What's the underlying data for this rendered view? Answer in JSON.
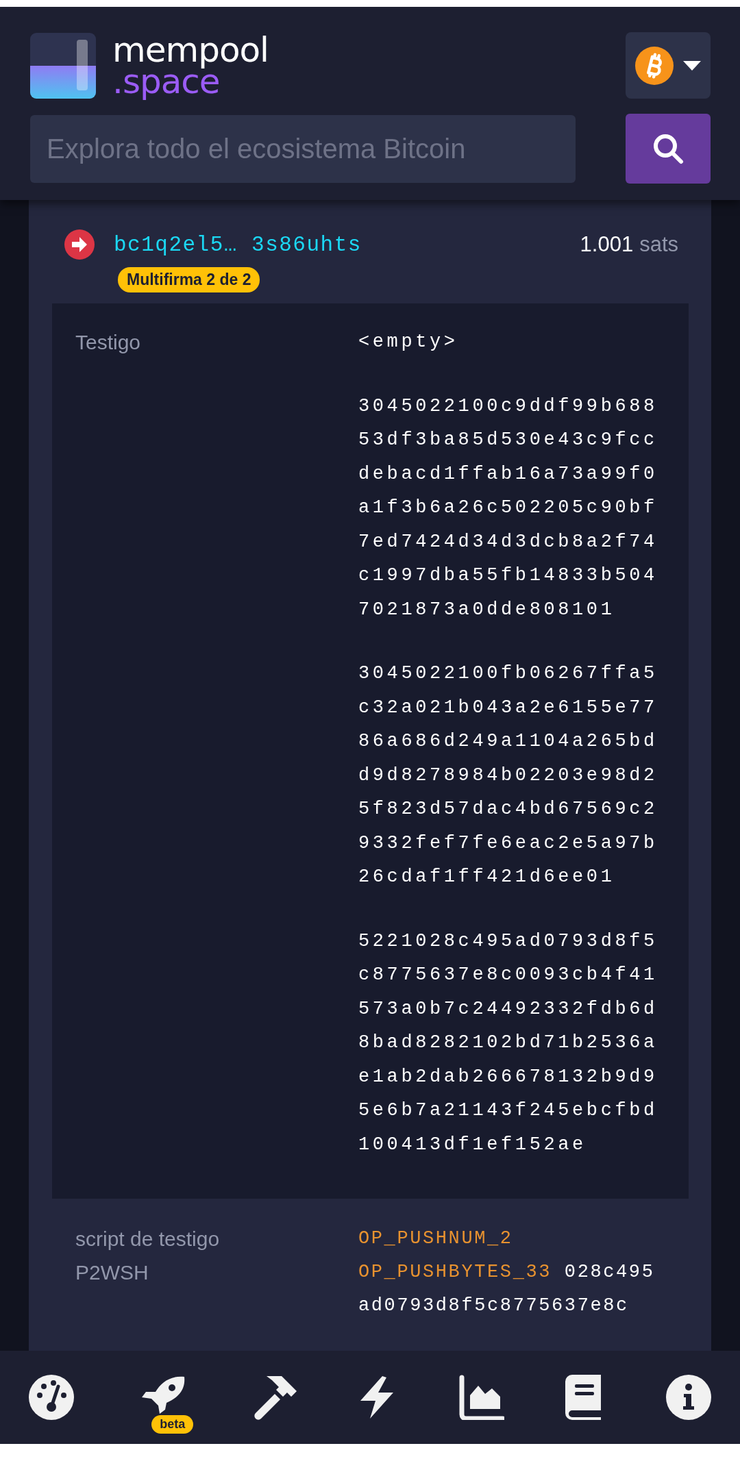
{
  "header": {
    "logo": {
      "line1": "mempool",
      "line2": ".space"
    },
    "search": {
      "placeholder": "Explora todo el ecosistema Bitcoin"
    }
  },
  "input": {
    "address": "bc1q2el5… 3s86uhts",
    "amount": "1.001",
    "unit": "sats",
    "badge": "Multifirma 2 de 2",
    "witness": {
      "label": "Testigo",
      "items": [
        "<empty>",
        "3045022100c9ddf99b68853df3ba85d530e43c9fccdebacd1ffab16a73a99f0a1f3b6a26c502205c90bf7ed7424d34d3dcb8a2f74c1997dba55fb14833b5047021873a0dde808101",
        "3045022100fb06267ffa5c32a021b043a2e6155e7786a686d249a1104a265bdd9d8278984b02203e98d25f823d57dac4bd67569c29332fef7fe6eac2e5a97b26cdaf1ff421d6ee01",
        "5221028c495ad0793d8f5c8775637e8c0093cb4f41573a0b7c24492332fdb6d8bad8282102bd71b2536ae1ab2dab266678132b9d95e6b7a21143f245ebcfbd100413df1ef152ae"
      ]
    },
    "script": {
      "label": "script de testigo P2WSH",
      "parts": [
        {
          "kind": "opcode",
          "text": "OP_PUSHNUM_2"
        },
        {
          "kind": "opcode",
          "text": "OP_PUSHBYTES_33"
        },
        {
          "kind": "data",
          "text": "028c495ad0793d8f5c8775637e8c"
        }
      ]
    }
  },
  "nav": [
    {
      "kind": "dashboard"
    },
    {
      "kind": "rocket",
      "badge": "beta"
    },
    {
      "kind": "hammer"
    },
    {
      "kind": "lightning"
    },
    {
      "kind": "chart"
    },
    {
      "kind": "book"
    },
    {
      "kind": "info"
    }
  ]
}
